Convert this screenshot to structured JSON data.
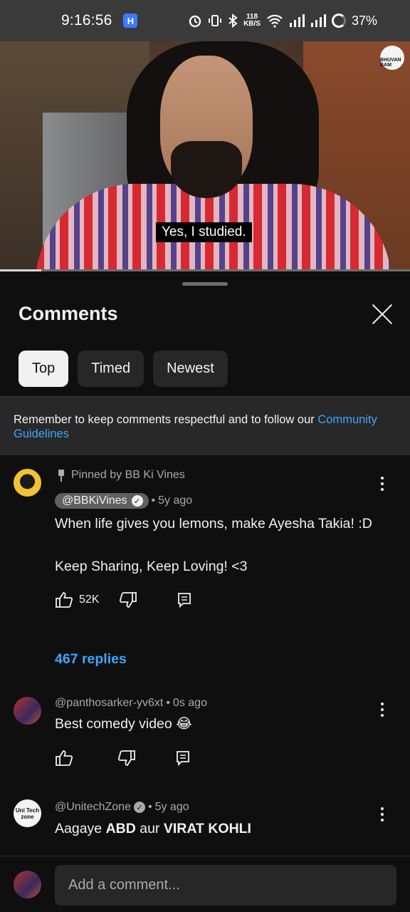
{
  "status_bar": {
    "time": "9:16:56",
    "app_badge": "H",
    "net_speed_value": "118",
    "net_speed_unit": "KB/S",
    "battery": "37%"
  },
  "video": {
    "subtitle": "Yes, I studied.",
    "channel_logo_text": "BHUVAN BAM",
    "progress": 0.1
  },
  "sheet": {
    "title": "Comments",
    "filters": [
      {
        "label": "Top",
        "active": true
      },
      {
        "label": "Timed",
        "active": false
      },
      {
        "label": "Newest",
        "active": false
      }
    ],
    "notice_text": "Remember to keep comments respectful and to follow our ",
    "notice_link": "Community Guidelines"
  },
  "comments": [
    {
      "pinned_label": "Pinned by BB Ki Vines",
      "author": "@BBKiVines",
      "verified": true,
      "age": "5y ago",
      "line1": "When life gives you lemons, make Ayesha Takia! :D",
      "line2": "Keep Sharing, Keep Loving! <3",
      "likes": "52K",
      "replies": "467 replies"
    },
    {
      "author": "@panthosarker-yv6xt",
      "age": "0s ago",
      "text": "Best comedy video 😂"
    },
    {
      "author": "@UnitechZone",
      "verified": true,
      "age": "5y ago",
      "text_pre": "Aagaye ",
      "text_b1": "ABD",
      "text_mid": " aur ",
      "text_b2": "VIRAT KOHLI",
      "avatar_text_top": "Uni Tech",
      "avatar_text_bottom": "zone"
    }
  ],
  "compose": {
    "placeholder": "Add a comment..."
  },
  "colors": {
    "background": "#0f0f0f",
    "chip": "#272727",
    "link": "#3ea6ff",
    "secondary_text": "#aaaaaa"
  }
}
